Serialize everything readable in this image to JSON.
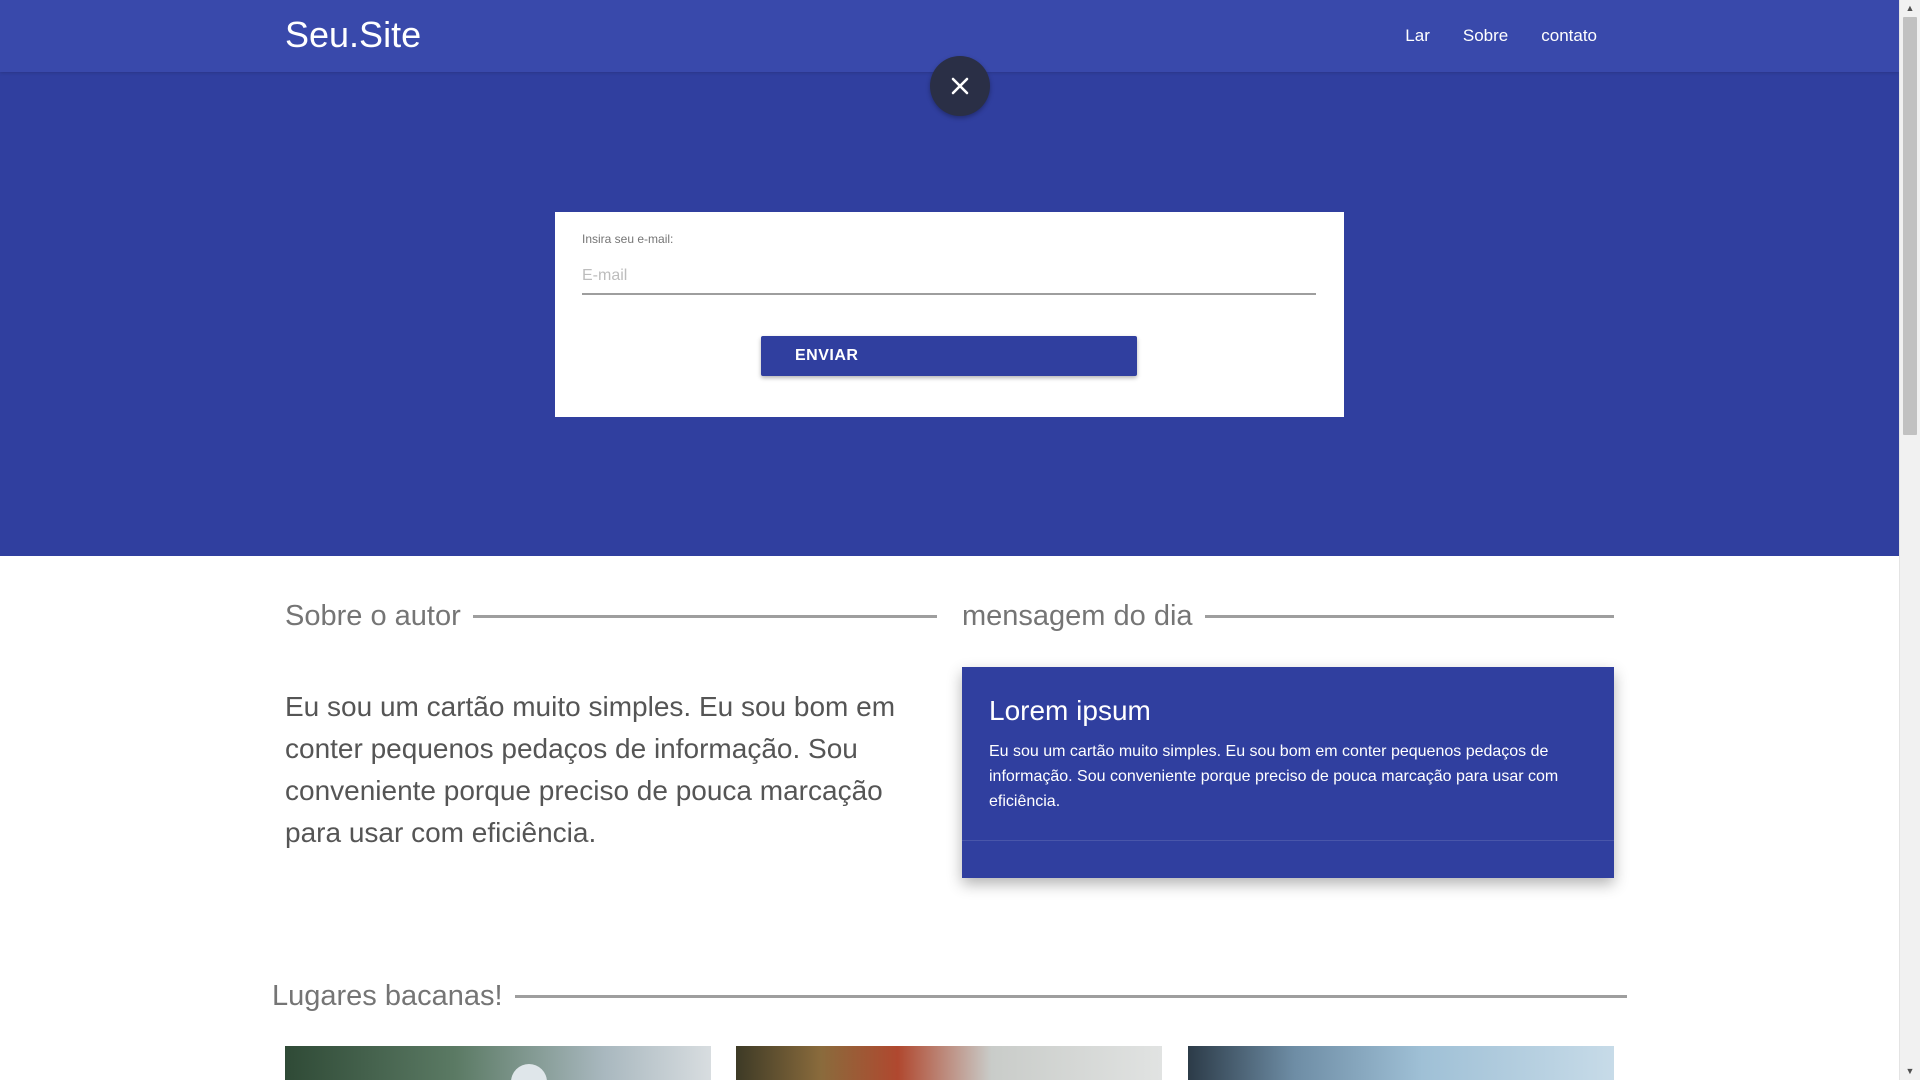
{
  "navbar": {
    "brand": "Seu.Site",
    "links": [
      "Lar",
      "Sobre",
      "contato"
    ]
  },
  "modal": {
    "close_icon": "close-icon",
    "form": {
      "label": "Insira seu e-mail:",
      "placeholder": "E-mail",
      "value": "",
      "submit_label": "ENVIAR"
    }
  },
  "about": {
    "title": "Sobre o autor",
    "text": "Eu sou um cartão muito simples. Eu sou bom em conter pequenos pedaços de informação. Sou conveniente porque preciso de pouca marcação para usar com eficiência."
  },
  "message": {
    "title": "mensagem do dia",
    "card_title": "Lorem ipsum",
    "card_body": "Eu sou um cartão muito simples. Eu sou bom em conter pequenos pedaços de informação. Sou conveniente porque preciso de pouca marcação para usar com eficiência."
  },
  "places": {
    "title": "Lugares bacanas!"
  },
  "colors": {
    "primary": "#303f9f",
    "navbar": "#3949ab",
    "close_button": "#2a2f46"
  }
}
